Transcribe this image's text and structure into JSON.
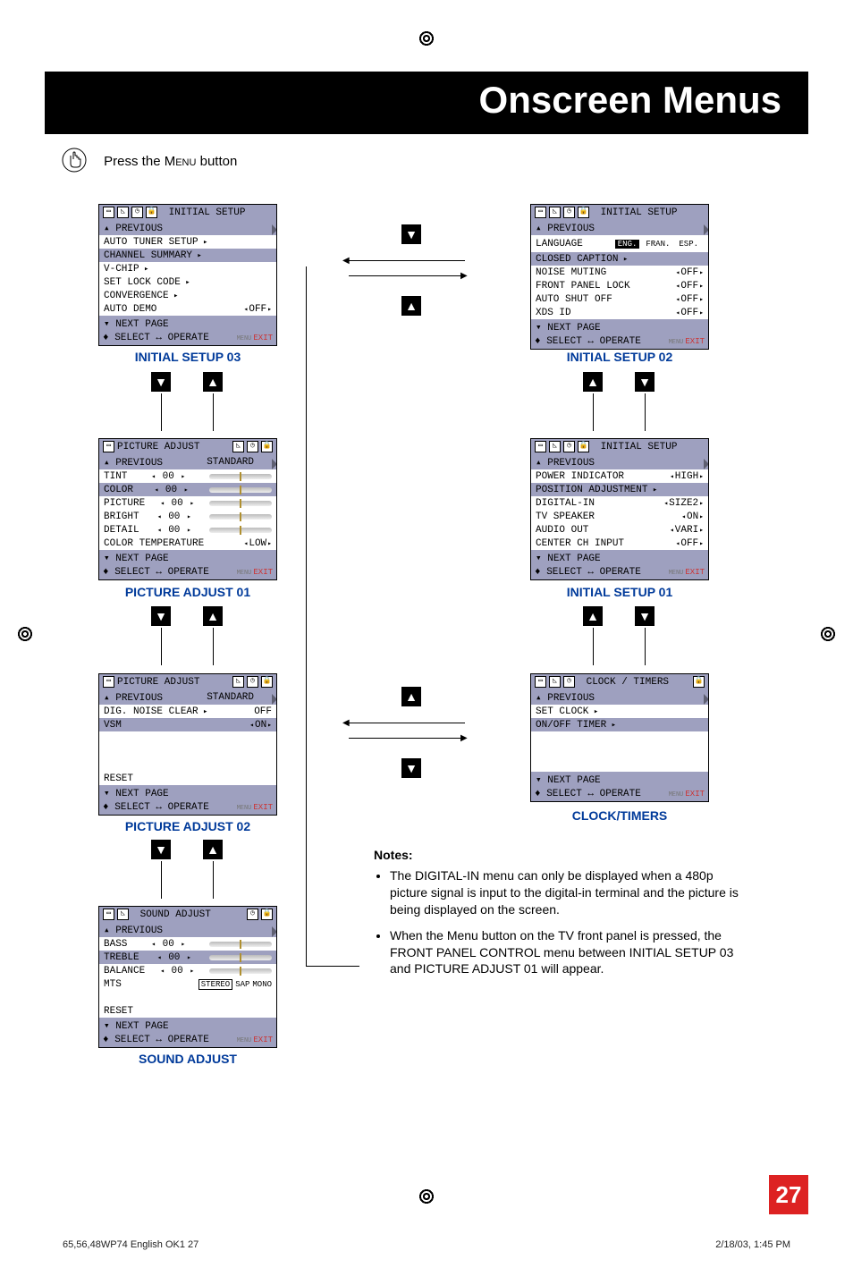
{
  "header": {
    "title": "Onscreen Menus"
  },
  "press_line": {
    "prefix": "Press the ",
    "key": "Menu",
    "suffix": " button"
  },
  "menus": {
    "initial_setup_03": {
      "title": "INITIAL SETUP",
      "rows": [
        {
          "label": "▴ PREVIOUS",
          "hl": true
        },
        {
          "label": "AUTO TUNER SETUP",
          "arrow": true
        },
        {
          "label": "CHANNEL SUMMARY",
          "arrow": true,
          "hl": true
        },
        {
          "label": "V-CHIP",
          "arrow": true
        },
        {
          "label": "SET LOCK CODE",
          "arrow": true
        },
        {
          "label": "CONVERGENCE",
          "arrow": true
        },
        {
          "label": "AUTO DEMO",
          "value": "OFF",
          "opt": true
        },
        {
          "label": "▾ NEXT PAGE",
          "hl": true
        }
      ],
      "caption": "INITIAL SETUP 03"
    },
    "initial_setup_02": {
      "title": "INITIAL SETUP",
      "rows": [
        {
          "label": "▴ PREVIOUS",
          "hl": true
        },
        {
          "label": "LANGUAGE",
          "langbar": true
        },
        {
          "label": "CLOSED CAPTION",
          "arrow": true,
          "hl": true
        },
        {
          "label": "NOISE MUTING",
          "value": "OFF",
          "opt": true
        },
        {
          "label": "FRONT PANEL LOCK",
          "value": "OFF",
          "opt": true
        },
        {
          "label": "AUTO SHUT OFF",
          "value": "OFF",
          "opt": true
        },
        {
          "label": "XDS ID",
          "value": "OFF",
          "opt": true
        },
        {
          "label": "▾ NEXT PAGE",
          "hl": true
        }
      ],
      "lang_opts": [
        "ENG.",
        "FRAN.",
        "ESP."
      ],
      "caption": "INITIAL SETUP 02"
    },
    "picture_adjust_01": {
      "title": "PICTURE ADJUST",
      "mode": "STANDARD",
      "rows": [
        {
          "label": "▴ PREVIOUS",
          "hl": true,
          "extra": "STANDARD"
        },
        {
          "label": "TINT",
          "val": "00",
          "slider": true
        },
        {
          "label": "COLOR",
          "val": "00",
          "slider": true,
          "hl": true
        },
        {
          "label": "PICTURE",
          "val": "00",
          "slider": true
        },
        {
          "label": "BRIGHT",
          "val": "00",
          "slider": true
        },
        {
          "label": "DETAIL",
          "val": "00",
          "slider": true
        },
        {
          "label": "COLOR TEMPERATURE",
          "value": "LOW",
          "opt": true
        },
        {
          "label": "▾ NEXT PAGE",
          "hl": true
        }
      ],
      "caption": "PICTURE ADJUST 01"
    },
    "initial_setup_01": {
      "title": "INITIAL SETUP",
      "rows": [
        {
          "label": "▴ PREVIOUS",
          "hl": true
        },
        {
          "label": "POWER INDICATOR",
          "value": "HIGH",
          "opt": true
        },
        {
          "label": "POSITION ADJUSTMENT",
          "arrow": true,
          "hl": true
        },
        {
          "label": "DIGITAL-IN",
          "value": "SIZE2",
          "opt": true
        },
        {
          "label": "TV SPEAKER",
          "value": "ON",
          "opt": true
        },
        {
          "label": "AUDIO OUT",
          "value": "VARI",
          "opt": true
        },
        {
          "label": "CENTER CH INPUT",
          "value": "OFF",
          "opt": true
        },
        {
          "label": "▾ NEXT PAGE",
          "hl": true
        }
      ],
      "caption": "INITIAL SETUP 01"
    },
    "picture_adjust_02": {
      "title": "PICTURE ADJUST",
      "rows": [
        {
          "label": "▴ PREVIOUS",
          "hl": true,
          "extra": "STANDARD"
        },
        {
          "label": "DIG. NOISE CLEAR",
          "arrow": true,
          "value": "OFF"
        },
        {
          "label": "VSM",
          "value": "ON",
          "opt": true,
          "hl": true
        },
        {
          "label": "",
          "blank": true
        },
        {
          "label": "",
          "blank": true
        },
        {
          "label": "",
          "blank": true
        },
        {
          "label": "RESET"
        },
        {
          "label": "▾ NEXT PAGE",
          "hl": true
        }
      ],
      "caption": "PICTURE ADJUST 02"
    },
    "clock_timers": {
      "title": "CLOCK / TIMERS",
      "rows": [
        {
          "label": "▴ PREVIOUS",
          "hl": true
        },
        {
          "label": "SET CLOCK",
          "arrow": true
        },
        {
          "label": "ON/OFF TIMER",
          "arrow": true,
          "hl": true
        },
        {
          "label": "",
          "blank": true
        },
        {
          "label": "",
          "blank": true
        },
        {
          "label": "",
          "blank": true
        },
        {
          "label": "▾ NEXT PAGE",
          "hl": true
        }
      ],
      "caption": "CLOCK/TIMERS"
    },
    "sound_adjust": {
      "title": "SOUND ADJUST",
      "rows": [
        {
          "label": "▴ PREVIOUS",
          "hl": true
        },
        {
          "label": "BASS",
          "val": "00",
          "slider": true
        },
        {
          "label": "TREBLE",
          "val": "00",
          "slider": true,
          "hl": true
        },
        {
          "label": "BALANCE",
          "val": "00",
          "slider": true
        },
        {
          "label": "MTS",
          "stereo": true
        },
        {
          "label": "",
          "blank": true
        },
        {
          "label": "RESET"
        },
        {
          "label": "▾ NEXT PAGE",
          "hl": true
        }
      ],
      "stereo_opts": [
        "STEREO",
        "SAP",
        "MONO"
      ],
      "caption": "SOUND ADJUST"
    }
  },
  "footer_hint": "SELECT ↔ OPERATE",
  "footer_exit": "EXIT",
  "footer_menu_tag": "MENU",
  "notes": {
    "heading": "Notes:",
    "items": [
      "The DIGITAL-IN menu can only be displayed when a 480p picture signal is input to the digital-in terminal and the picture is being displayed on the screen.",
      "When the Menu button on the TV front panel is pressed, the FRONT PANEL CONTROL menu between INITIAL SETUP 03 and PICTURE ADJUST 01 will appear."
    ]
  },
  "page_number": "27",
  "footer_meta": {
    "left": "65,56,48WP74 English OK1   27",
    "right": "2/18/03, 1:45 PM"
  }
}
